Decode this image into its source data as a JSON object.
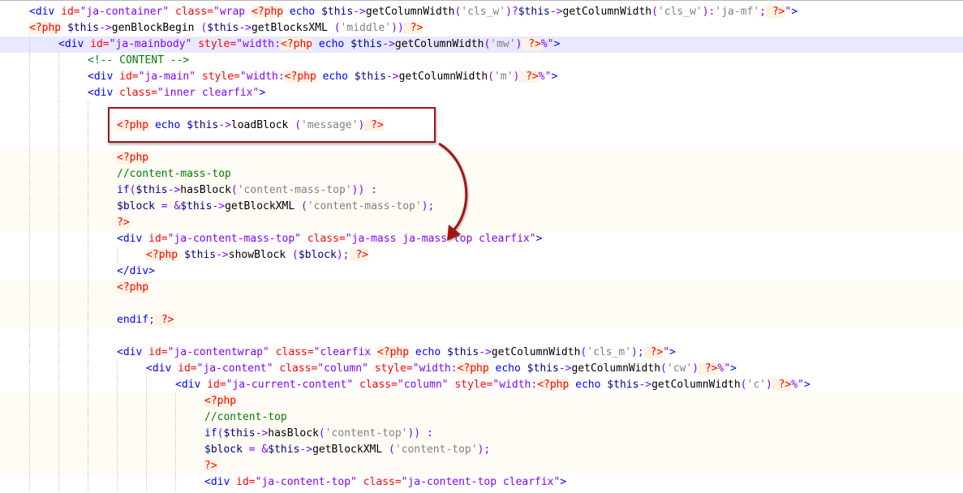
{
  "editor": {
    "lines": [
      [
        [
          "tag",
          "<div "
        ],
        [
          "attr",
          "id="
        ],
        [
          "str",
          "\"ja-container\""
        ],
        [
          "tag",
          " "
        ],
        [
          "attr",
          "class="
        ],
        [
          "str",
          "\"wrap "
        ],
        [
          "php",
          "<?php"
        ],
        [
          "kw",
          " echo "
        ],
        [
          "var",
          "$this"
        ],
        [
          "op",
          "->"
        ],
        [
          "fn",
          "getColumnWidth"
        ],
        [
          "op",
          "("
        ],
        [
          "sq",
          "'cls_w'"
        ],
        [
          "op",
          ")?"
        ],
        [
          "var",
          "$this"
        ],
        [
          "op",
          "->"
        ],
        [
          "fn",
          "getColumnWidth"
        ],
        [
          "op",
          "("
        ],
        [
          "sq",
          "'cls_w'"
        ],
        [
          "op",
          "):"
        ],
        [
          "sq",
          "'ja-mf'"
        ],
        [
          "op",
          ";"
        ],
        [
          "php",
          " ?>"
        ],
        [
          "str",
          "\""
        ],
        [
          "tag",
          ">"
        ]
      ],
      [
        [
          "php",
          "<?php"
        ],
        [
          "var",
          " $this"
        ],
        [
          "op",
          "->"
        ],
        [
          "fn",
          "genBlockBegin "
        ],
        [
          "op",
          "("
        ],
        [
          "var",
          "$this"
        ],
        [
          "op",
          "->"
        ],
        [
          "fn",
          "getBlocksXML "
        ],
        [
          "op",
          "("
        ],
        [
          "sq",
          "'middle'"
        ],
        [
          "op",
          "))"
        ],
        [
          "php",
          " ?>"
        ]
      ],
      [
        [
          "tag",
          "<div "
        ],
        [
          "attr",
          "id="
        ],
        [
          "str",
          "\"ja-mainbody\""
        ],
        [
          "tag",
          " "
        ],
        [
          "attr",
          "style="
        ],
        [
          "str",
          "\"width:"
        ],
        [
          "php",
          "<?php"
        ],
        [
          "kw",
          " echo "
        ],
        [
          "var",
          "$this"
        ],
        [
          "op",
          "->"
        ],
        [
          "fn",
          "getColumnWidth"
        ],
        [
          "op",
          "("
        ],
        [
          "sq",
          "'mw'"
        ],
        [
          "op",
          ")"
        ],
        [
          "php",
          " ?>"
        ],
        [
          "str",
          "%\""
        ],
        [
          "tag",
          ">"
        ]
      ],
      [
        [
          "cm",
          "<!-- CONTENT -->"
        ]
      ],
      [
        [
          "tag",
          "<div "
        ],
        [
          "attr",
          "id="
        ],
        [
          "str",
          "\"ja-main\""
        ],
        [
          "tag",
          " "
        ],
        [
          "attr",
          "style="
        ],
        [
          "str",
          "\"width:"
        ],
        [
          "php",
          "<?php"
        ],
        [
          "kw",
          " echo "
        ],
        [
          "var",
          "$this"
        ],
        [
          "op",
          "->"
        ],
        [
          "fn",
          "getColumnWidth"
        ],
        [
          "op",
          "("
        ],
        [
          "sq",
          "'m'"
        ],
        [
          "op",
          ")"
        ],
        [
          "php",
          " ?>"
        ],
        [
          "str",
          "%\""
        ],
        [
          "tag",
          ">"
        ]
      ],
      [
        [
          "tag",
          "<div "
        ],
        [
          "attr",
          "class="
        ],
        [
          "str",
          "\"inner clearfix\""
        ],
        [
          "tag",
          ">"
        ]
      ],
      [],
      [
        [
          "php",
          "<?php"
        ],
        [
          "kw",
          " echo "
        ],
        [
          "var",
          "$this"
        ],
        [
          "op",
          "->"
        ],
        [
          "fn",
          "loadBlock "
        ],
        [
          "op",
          "("
        ],
        [
          "sq",
          "'message'"
        ],
        [
          "op",
          ")"
        ],
        [
          "php",
          " ?>"
        ]
      ],
      [],
      [
        [
          "php",
          "<?php"
        ]
      ],
      [
        [
          "cm",
          "//content-mass-top"
        ]
      ],
      [
        [
          "kw",
          "if"
        ],
        [
          "op",
          "("
        ],
        [
          "var",
          "$this"
        ],
        [
          "op",
          "->"
        ],
        [
          "fn",
          "hasBlock"
        ],
        [
          "op",
          "("
        ],
        [
          "sq",
          "'content-mass-top'"
        ],
        [
          "op",
          ")) :"
        ]
      ],
      [
        [
          "var",
          "$block"
        ],
        [
          "op",
          " = &"
        ],
        [
          "var",
          "$this"
        ],
        [
          "op",
          "->"
        ],
        [
          "fn",
          "getBlockXML "
        ],
        [
          "op",
          "("
        ],
        [
          "sq",
          "'content-mass-top'"
        ],
        [
          "op",
          ");"
        ]
      ],
      [
        [
          "php",
          "?>"
        ]
      ],
      [
        [
          "tag",
          "<div "
        ],
        [
          "attr",
          "id="
        ],
        [
          "str",
          "\"ja-content-mass-top\""
        ],
        [
          "tag",
          " "
        ],
        [
          "attr",
          "class="
        ],
        [
          "str",
          "\"ja-mass ja-mass-top clearfix\""
        ],
        [
          "tag",
          ">"
        ]
      ],
      [
        [
          "php",
          "<?php"
        ],
        [
          "var",
          " $this"
        ],
        [
          "op",
          "->"
        ],
        [
          "fn",
          "showBlock "
        ],
        [
          "op",
          "("
        ],
        [
          "var",
          "$block"
        ],
        [
          "op",
          ");"
        ],
        [
          "php",
          " ?>"
        ]
      ],
      [
        [
          "tag",
          "</div>"
        ]
      ],
      [
        [
          "php",
          "<?php"
        ]
      ],
      [],
      [
        [
          "kw",
          "endif"
        ],
        [
          "op",
          ";"
        ],
        [
          "php",
          " ?>"
        ]
      ],
      [],
      [
        [
          "tag",
          "<div "
        ],
        [
          "attr",
          "id="
        ],
        [
          "str",
          "\"ja-contentwrap\""
        ],
        [
          "tag",
          " "
        ],
        [
          "attr",
          "class="
        ],
        [
          "str",
          "\"clearfix "
        ],
        [
          "php",
          "<?php"
        ],
        [
          "kw",
          " echo "
        ],
        [
          "var",
          "$this"
        ],
        [
          "op",
          "->"
        ],
        [
          "fn",
          "getColumnWidth"
        ],
        [
          "op",
          "("
        ],
        [
          "sq",
          "'cls_m'"
        ],
        [
          "op",
          ");"
        ],
        [
          "php",
          " ?>"
        ],
        [
          "str",
          "\""
        ],
        [
          "tag",
          ">"
        ]
      ],
      [
        [
          "tag",
          "<div "
        ],
        [
          "attr",
          "id="
        ],
        [
          "str",
          "\"ja-content\""
        ],
        [
          "tag",
          " "
        ],
        [
          "attr",
          "class="
        ],
        [
          "str",
          "\"column\""
        ],
        [
          "tag",
          " "
        ],
        [
          "attr",
          "style="
        ],
        [
          "str",
          "\"width:"
        ],
        [
          "php",
          "<?php"
        ],
        [
          "kw",
          " echo "
        ],
        [
          "var",
          "$this"
        ],
        [
          "op",
          "->"
        ],
        [
          "fn",
          "getColumnWidth"
        ],
        [
          "op",
          "("
        ],
        [
          "sq",
          "'cw'"
        ],
        [
          "op",
          ")"
        ],
        [
          "php",
          " ?>"
        ],
        [
          "str",
          "%\""
        ],
        [
          "tag",
          ">"
        ]
      ],
      [
        [
          "tag",
          "<div "
        ],
        [
          "attr",
          "id="
        ],
        [
          "str",
          "\"ja-current-content\""
        ],
        [
          "tag",
          " "
        ],
        [
          "attr",
          "class="
        ],
        [
          "str",
          "\"column\""
        ],
        [
          "tag",
          " "
        ],
        [
          "attr",
          "style="
        ],
        [
          "str",
          "\"width:"
        ],
        [
          "php",
          "<?php"
        ],
        [
          "kw",
          " echo "
        ],
        [
          "var",
          "$this"
        ],
        [
          "op",
          "->"
        ],
        [
          "fn",
          "getColumnWidth"
        ],
        [
          "op",
          "("
        ],
        [
          "sq",
          "'c'"
        ],
        [
          "op",
          ")"
        ],
        [
          "php",
          " ?>"
        ],
        [
          "str",
          "%\""
        ],
        [
          "tag",
          ">"
        ]
      ],
      [
        [
          "php",
          "<?php"
        ]
      ],
      [
        [
          "cm",
          "//content-top"
        ]
      ],
      [
        [
          "kw",
          "if"
        ],
        [
          "op",
          "("
        ],
        [
          "var",
          "$this"
        ],
        [
          "op",
          "->"
        ],
        [
          "fn",
          "hasBlock"
        ],
        [
          "op",
          "("
        ],
        [
          "sq",
          "'content-top'"
        ],
        [
          "op",
          ")) :"
        ]
      ],
      [
        [
          "var",
          "$block"
        ],
        [
          "op",
          " = &"
        ],
        [
          "var",
          "$this"
        ],
        [
          "op",
          "->"
        ],
        [
          "fn",
          "getBlockXML "
        ],
        [
          "op",
          "("
        ],
        [
          "sq",
          "'content-top'"
        ],
        [
          "op",
          ");"
        ]
      ],
      [
        [
          "php",
          "?>"
        ]
      ],
      [
        [
          "tag",
          "<div "
        ],
        [
          "attr",
          "id="
        ],
        [
          "str",
          "\"ja-content-top\""
        ],
        [
          "tag",
          " "
        ],
        [
          "attr",
          "class="
        ],
        [
          "str",
          "\"ja-content-top clearfix\""
        ],
        [
          "tag",
          ">"
        ]
      ]
    ]
  },
  "colors": {
    "highlight_border": "#a31515",
    "arrow": "#a31515"
  },
  "icons": {
    "annotation": "curved-arrow-icon"
  }
}
